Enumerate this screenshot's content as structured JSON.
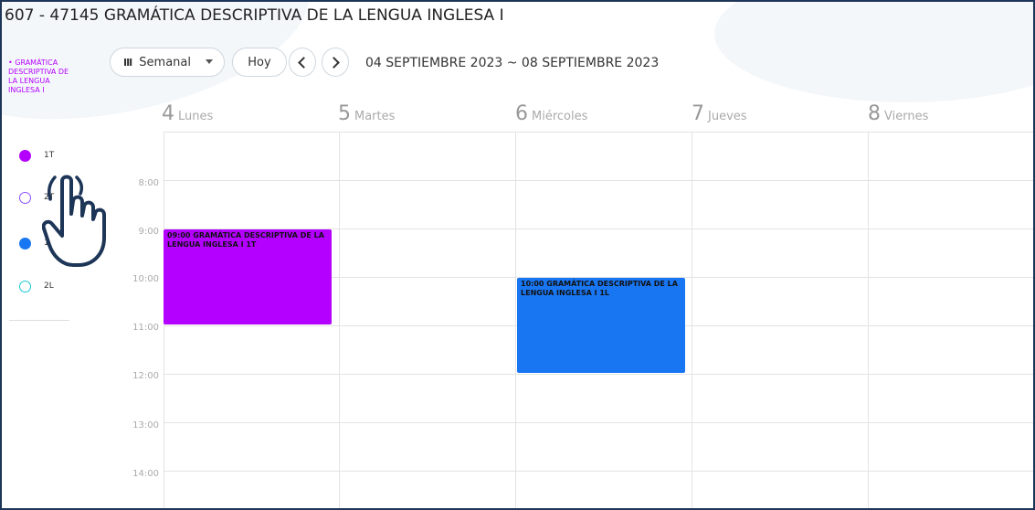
{
  "page": {
    "title": "607 - 47145 GRAMÁTICA DESCRIPTIVA DE LA LENGUA INGLESA I"
  },
  "toolbar": {
    "view_label": "Semanal",
    "today_label": "Hoy",
    "date_range": "04 SEPTIEMBRE 2023 ~ 08 SEPTIEMBRE 2023"
  },
  "sidebar": {
    "course": "• GRAMÁTICA DESCRIPTIVA DE LA LENGUA INGLESA I",
    "calendars": [
      {
        "name": "1T",
        "color": "#b400ff",
        "filled": true
      },
      {
        "name": "2T",
        "color": "#8a4dff",
        "filled": false
      },
      {
        "name": "1L",
        "color": "#1976f2",
        "filled": true
      },
      {
        "name": "2L",
        "color": "#19c6d6",
        "filled": false
      }
    ]
  },
  "days": [
    {
      "num": "4",
      "name": "Lunes"
    },
    {
      "num": "5",
      "name": "Martes"
    },
    {
      "num": "6",
      "name": "Miércoles"
    },
    {
      "num": "7",
      "name": "Jueves"
    },
    {
      "num": "8",
      "name": "Viernes"
    }
  ],
  "times": [
    "8:00",
    "9:00",
    "10:00",
    "11:00",
    "12:00",
    "13:00",
    "14:00"
  ],
  "events": [
    {
      "title": "09:00 GRAMÁTICA DESCRIPTIVA DE LA LENGUA INGLESA I 1T",
      "color": "#b400ff"
    },
    {
      "title": "10:00 GRAMÁTICA DESCRIPTIVA DE LA LENGUA INGLESA I 1L",
      "color": "#1976f2"
    }
  ]
}
